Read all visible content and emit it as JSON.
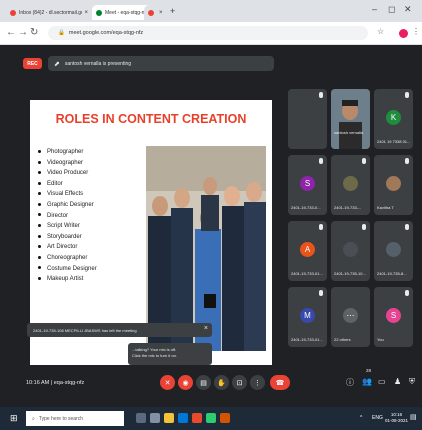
{
  "browser": {
    "tabs": [
      {
        "label": "Inbox (84)2 - dl.sectormail.gov.in",
        "favicon_color": "#ea4335"
      },
      {
        "label": "Meet - eqa-stqg-nfz",
        "favicon_color": "#00832d"
      },
      {
        "label": "",
        "favicon_color": "#ea4335"
      }
    ],
    "new_tab": "+",
    "url": "meet.google.com/eqa-stqg-nfz",
    "window_controls": [
      "⌄",
      "–",
      "◻",
      "✕"
    ]
  },
  "meet": {
    "rec_label": "REC",
    "presenting_text": "santosh vernalla is presenting",
    "slide": {
      "title": "ROLES IN CONTENT CREATION",
      "title_color": "#e8412a",
      "roles": [
        "Photographer",
        "Videographer",
        "Video Producer",
        "Editor",
        "Visual Effects",
        "Graphic Designer",
        "Director",
        "Script Writer",
        "Storyboarder",
        "Art Director",
        "Choreographer",
        "Costume Designer",
        "Makeup Artist"
      ]
    },
    "participants": [
      {
        "avatar": "S",
        "color": "#3c4043",
        "name": "",
        "kind": "muted"
      },
      {
        "avatar": "",
        "color": "#5a6a7a",
        "name": "santosh vernalla",
        "kind": "video"
      },
      {
        "avatar": "K",
        "color": "#1e8e3e",
        "name": "2401 19 7338 01...",
        "kind": "letter"
      },
      {
        "avatar": "S",
        "color": "#8e24aa",
        "name": "2401-19-733-0...",
        "kind": "letter"
      },
      {
        "avatar": "",
        "color": "#6d6a4a",
        "name": "2401-19-733-...",
        "kind": "photo"
      },
      {
        "avatar": "",
        "color": "#a0785a",
        "name": "Kavitha T",
        "kind": "photo"
      },
      {
        "avatar": "A",
        "color": "#e8541a",
        "name": "2401-19-733-01...",
        "kind": "letter"
      },
      {
        "avatar": "",
        "color": "#4a4f55",
        "name": "2401-19-735-10...",
        "kind": "photo"
      },
      {
        "avatar": "",
        "color": "#4a4f55",
        "name": "2401-19-735-8...",
        "kind": "photo"
      },
      {
        "avatar": "M",
        "color": "#3949ab",
        "name": "2401-19-733-01...",
        "kind": "letter"
      },
      {
        "avatar": "",
        "color": "#5f6368",
        "name": "22 others",
        "kind": "others"
      },
      {
        "avatar": "S",
        "color": "#e84393",
        "name": "You",
        "kind": "letter"
      }
    ],
    "toast": {
      "text": "2401-19-735-108 MECPILLI JBASWS has left the meeting",
      "close": "×"
    },
    "tooltip": {
      "line1": "...talking? Your mic is off.",
      "line2": "Click the mic to turn it on."
    },
    "meeting_info": "10:16 AM  |  eqa-stqg-nfz",
    "controls": [
      {
        "name": "mic-toggle-button",
        "glyph": "🎤",
        "bg": "#ea4335"
      },
      {
        "name": "camera-toggle-button",
        "glyph": "◉",
        "bg": "#ea4335"
      },
      {
        "name": "captions-button",
        "glyph": "▤",
        "bg": "#3c4043"
      },
      {
        "name": "raise-hand-button",
        "glyph": "✋",
        "bg": "#3c4043"
      },
      {
        "name": "present-button",
        "glyph": "⊡",
        "bg": "#3c4043"
      },
      {
        "name": "more-options-button",
        "glyph": "⋮",
        "bg": "#3c4043"
      },
      {
        "name": "leave-call-button",
        "glyph": "☎",
        "bg": "#ea4335"
      }
    ],
    "right_controls": [
      {
        "name": "info-button",
        "glyph": "ⓘ"
      },
      {
        "name": "people-button",
        "glyph": "👥"
      },
      {
        "name": "chat-button",
        "glyph": "▭"
      },
      {
        "name": "activities-button",
        "glyph": "♟"
      },
      {
        "name": "host-controls-button",
        "glyph": "⛨"
      }
    ],
    "people_count": "28"
  },
  "taskbar": {
    "search_placeholder": "Type here to search",
    "time": "10:16",
    "date": "01-08-2021",
    "lang": "ENG"
  }
}
